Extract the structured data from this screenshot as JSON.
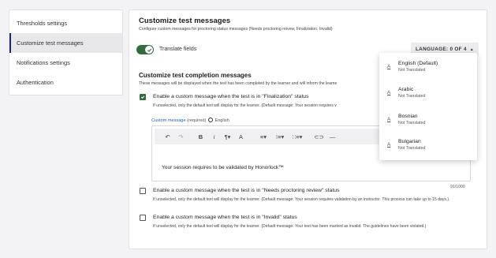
{
  "sidebar": {
    "items": [
      {
        "label": "Thresholds settings",
        "active": false
      },
      {
        "label": "Customize test messages",
        "active": true
      },
      {
        "label": "Notifications settings",
        "active": false
      },
      {
        "label": "Authentication",
        "active": false
      }
    ]
  },
  "header": {
    "title": "Customize test messages",
    "subtitle": "Configure custom messages for proctoring status messages (Needs proctoring reivew, Finalization, Invalid)"
  },
  "translate": {
    "label": "Translate fields",
    "enabled": true
  },
  "language_button": {
    "label": "LANGUAGE: 0 OF 4"
  },
  "language_menu": {
    "items": [
      {
        "name": "English (Default)",
        "status": "Not Translated"
      },
      {
        "name": "Arabic",
        "status": "Not Translated"
      },
      {
        "name": "Bosnian",
        "status": "Not Translated"
      },
      {
        "name": "Bulgarian",
        "status": "Not Translated"
      }
    ],
    "icon_glyph": "A"
  },
  "completion": {
    "title": "Customize test completion messages",
    "description": "These messages will be displayed when the test has been completed by the learner and will inform the learne",
    "options": [
      {
        "checked": true,
        "label": "Enable a custom message when the test is in \"Finalization\" status",
        "help": "If unselected, only the default text will display for the learner. (Default message: Your session requires v"
      },
      {
        "checked": false,
        "label": "Enable a custom message when the test is in \"Needs proctoring review\" status",
        "help": "If unselected, only the default text will display for the learner. (Default message: Your session requires validation by an instructor. This process can take up to 15 days.)."
      },
      {
        "checked": false,
        "label": "Enable a custom message when the test is in \"Invalid\" status",
        "help": "If unselected, only the default text will display for the learner. (Default message: Your test has been marked as invalid. The guidelines have been violated.)"
      }
    ]
  },
  "custom_message": {
    "link": "Custom message",
    "required": "(required)",
    "language": "English",
    "toolbar": {
      "undo": "↶",
      "redo": "↷",
      "bold": "B",
      "italic": "i",
      "paragraph": "¶▾",
      "color": "A",
      "align": "≡▾",
      "ordered_list": "⁝≡▾",
      "bullet_list": "∷≡▾",
      "link": "⊂⊃",
      "hr": "—"
    },
    "text": "Your session requires to be validated by Honorlock™",
    "counter": "91/1000"
  }
}
